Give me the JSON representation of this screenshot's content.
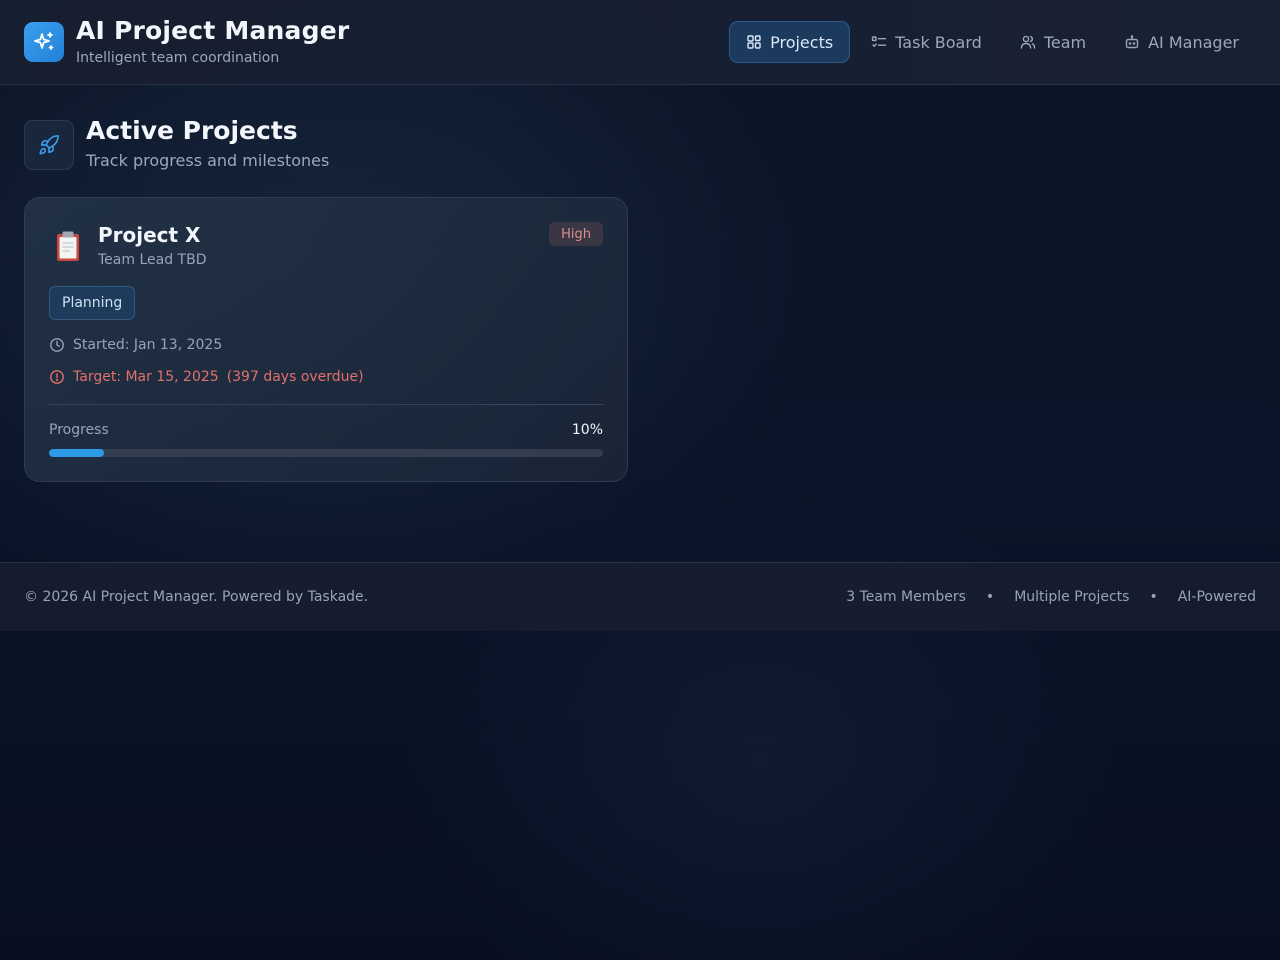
{
  "header": {
    "title": "AI Project Manager",
    "subtitle": "Intelligent team coordination",
    "logo_icon": "sparkles-icon",
    "nav": [
      {
        "label": "Projects",
        "icon": "grid-icon",
        "active": true
      },
      {
        "label": "Task Board",
        "icon": "list-checks-icon",
        "active": false
      },
      {
        "label": "Team",
        "icon": "users-icon",
        "active": false
      },
      {
        "label": "AI Manager",
        "icon": "bot-icon",
        "active": false
      }
    ]
  },
  "section": {
    "title": "Active Projects",
    "subtitle": "Track progress and milestones",
    "icon": "rocket-icon"
  },
  "project": {
    "emoji": "clipboard-icon",
    "name": "Project X",
    "lead": "Team Lead TBD",
    "priority": "High",
    "status": "Planning",
    "started": "Started: Jan 13, 2025",
    "target": "Target: Mar 15, 2025",
    "overdue": "(397 days overdue)",
    "progress_label": "Progress",
    "progress_text": "10%",
    "progress": 0.1
  },
  "footer": {
    "copyright": "© 2026 AI Project Manager. Powered by Taskade.",
    "stats": [
      "3 Team Members",
      "Multiple Projects",
      "AI-Powered"
    ],
    "separator": "•"
  },
  "colors": {
    "accent": "#2e9be8",
    "overdue": "#e0706a",
    "priority_high": "#d98f8f"
  }
}
